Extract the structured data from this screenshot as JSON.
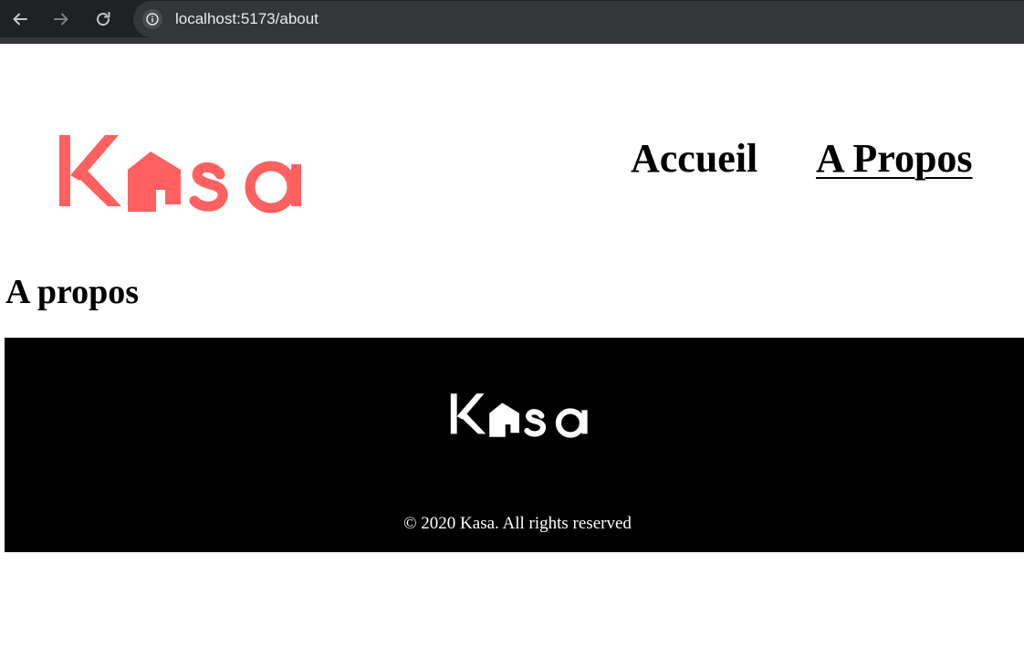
{
  "browser": {
    "url": "localhost:5173/about",
    "icons": [
      "back-arrow-icon",
      "forward-arrow-icon",
      "reload-icon",
      "site-info-icon"
    ]
  },
  "header": {
    "logo_text": "Kasa",
    "nav": [
      {
        "label": "Accueil",
        "active": false
      },
      {
        "label": "A Propos",
        "active": true
      }
    ]
  },
  "main": {
    "title": "A propos"
  },
  "footer": {
    "logo_text": "Kasa",
    "copyright": "© 2020 Kasa. All rights reserved"
  },
  "colors": {
    "brand": "#ff6060",
    "footer_bg": "#000000",
    "footer_text": "#ffffff",
    "chrome_bg": "#202124"
  }
}
